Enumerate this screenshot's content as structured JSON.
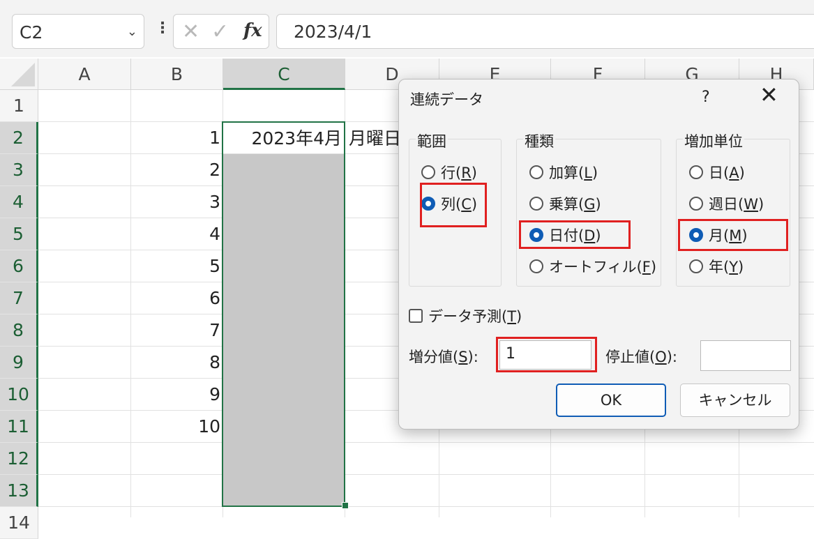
{
  "formula_bar": {
    "name_box": "C2",
    "name_box_chevron": "chevron-down-icon",
    "more_icon": "vertical-dots-icon",
    "cancel_icon": "✕",
    "enter_icon": "✓",
    "fx_label": "fx",
    "formula": "2023/4/1"
  },
  "grid": {
    "columns": [
      "A",
      "B",
      "C",
      "D",
      "E",
      "F",
      "G",
      "H"
    ],
    "selected_column": "C",
    "rows": [
      "1",
      "2",
      "3",
      "4",
      "5",
      "6",
      "7",
      "8",
      "9",
      "10",
      "11",
      "12",
      "13",
      "14"
    ],
    "col_b_values": [
      "1",
      "2",
      "3",
      "4",
      "5",
      "6",
      "7",
      "8",
      "9",
      "10"
    ],
    "c2": "2023年4月",
    "d2": "月曜日"
  },
  "dialog": {
    "title": "連続データ",
    "help": "?",
    "close": "✕",
    "range_group": {
      "label": "範囲",
      "options": [
        {
          "text": "行(",
          "key": "R",
          "end": ")",
          "selected": false
        },
        {
          "text": "列(",
          "key": "C",
          "end": ")",
          "selected": true
        }
      ]
    },
    "type_group": {
      "label": "種類",
      "options": [
        {
          "text": "加算(",
          "key": "L",
          "end": ")",
          "selected": false
        },
        {
          "text": "乗算(",
          "key": "G",
          "end": ")",
          "selected": false
        },
        {
          "text": "日付(",
          "key": "D",
          "end": ")",
          "selected": true
        },
        {
          "text": "オートフィル(",
          "key": "F",
          "end": ")",
          "selected": false
        }
      ]
    },
    "unit_group": {
      "label": "増加単位",
      "options": [
        {
          "text": "日(",
          "key": "A",
          "end": ")",
          "selected": false
        },
        {
          "text": "週日(",
          "key": "W",
          "end": ")",
          "selected": false
        },
        {
          "text": "月(",
          "key": "M",
          "end": ")",
          "selected": true
        },
        {
          "text": "年(",
          "key": "Y",
          "end": ")",
          "selected": false
        }
      ]
    },
    "trend": {
      "text": "データ予測(",
      "key": "T",
      "end": ")",
      "checked": false
    },
    "step": {
      "text": "増分値(",
      "key": "S",
      "end": "):",
      "value": "1"
    },
    "stop": {
      "text": "停止値(",
      "key": "O",
      "end": "):",
      "value": ""
    },
    "ok": "OK",
    "cancel": "キャンセル",
    "highlight_color": "#e02020",
    "accent_color": "#0f5cb5"
  }
}
